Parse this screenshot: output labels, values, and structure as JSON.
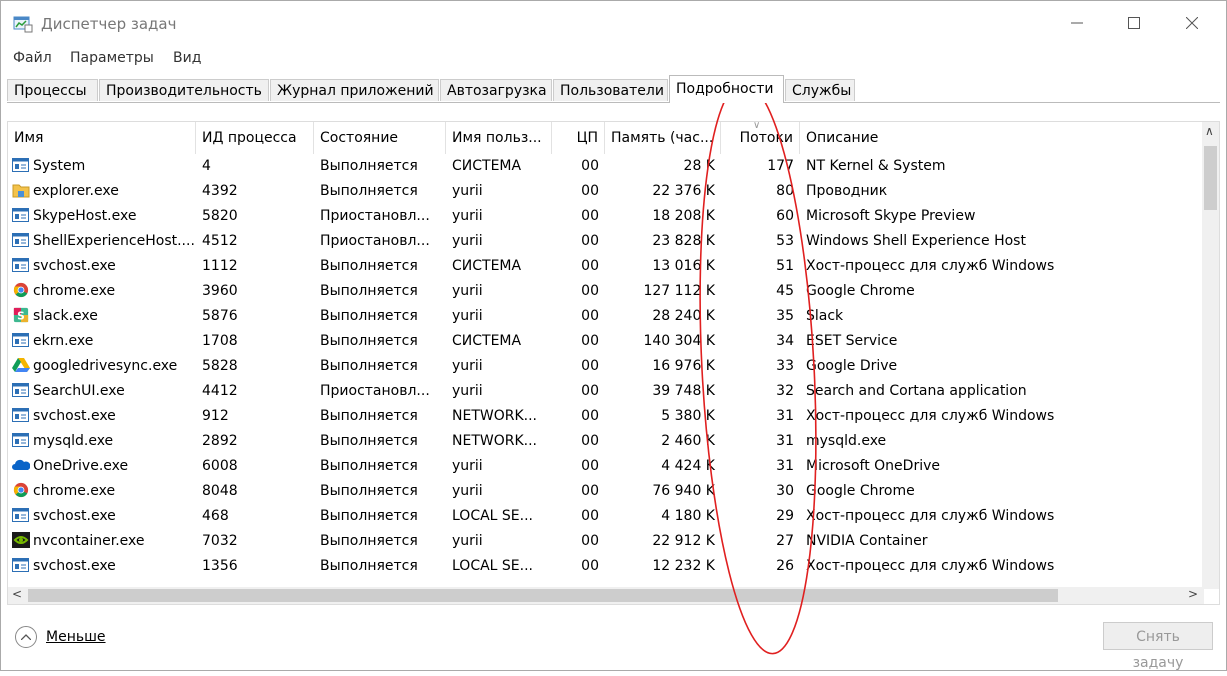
{
  "window": {
    "title": "Диспетчер задач"
  },
  "menu": [
    "Файл",
    "Параметры",
    "Вид"
  ],
  "tabs": [
    "Процессы",
    "Производительность",
    "Журнал приложений",
    "Автозагрузка",
    "Пользователи",
    "Подробности",
    "Службы"
  ],
  "active_tab": "Подробности",
  "columns": [
    "Имя",
    "ИД процесса",
    "Состояние",
    "Имя польз...",
    "ЦП",
    "Память (час...",
    "Потоки",
    "Описание"
  ],
  "sorted_column": "Потоки",
  "rows": [
    {
      "icon": "window-process-icon",
      "name": "System",
      "pid": "4",
      "status": "Выполняется",
      "user": "СИСТЕМА",
      "cpu": "00",
      "memory": "28 K",
      "threads": "177",
      "description": "NT Kernel & System"
    },
    {
      "icon": "folder-icon",
      "name": "explorer.exe",
      "pid": "4392",
      "status": "Выполняется",
      "user": "yurii",
      "cpu": "00",
      "memory": "22 376 K",
      "threads": "80",
      "description": "Проводник"
    },
    {
      "icon": "window-process-icon",
      "name": "SkypeHost.exe",
      "pid": "5820",
      "status": "Приостановл...",
      "user": "yurii",
      "cpu": "00",
      "memory": "18 208 K",
      "threads": "60",
      "description": "Microsoft Skype Preview"
    },
    {
      "icon": "window-process-icon",
      "name": "ShellExperienceHost....",
      "pid": "4512",
      "status": "Приостановл...",
      "user": "yurii",
      "cpu": "00",
      "memory": "23 828 K",
      "threads": "53",
      "description": "Windows Shell Experience Host"
    },
    {
      "icon": "window-process-icon",
      "name": "svchost.exe",
      "pid": "1112",
      "status": "Выполняется",
      "user": "СИСТЕМА",
      "cpu": "00",
      "memory": "13 016 K",
      "threads": "51",
      "description": "Хост-процесс для служб Windows"
    },
    {
      "icon": "chrome-icon",
      "name": "chrome.exe",
      "pid": "3960",
      "status": "Выполняется",
      "user": "yurii",
      "cpu": "00",
      "memory": "127 112 K",
      "threads": "45",
      "description": "Google Chrome"
    },
    {
      "icon": "slack-icon",
      "name": "slack.exe",
      "pid": "5876",
      "status": "Выполняется",
      "user": "yurii",
      "cpu": "00",
      "memory": "28 240 K",
      "threads": "35",
      "description": "Slack"
    },
    {
      "icon": "window-process-icon",
      "name": "ekrn.exe",
      "pid": "1708",
      "status": "Выполняется",
      "user": "СИСТЕМА",
      "cpu": "00",
      "memory": "140 304 K",
      "threads": "34",
      "description": "ESET Service"
    },
    {
      "icon": "google-drive-icon",
      "name": "googledrivesync.exe",
      "pid": "5828",
      "status": "Выполняется",
      "user": "yurii",
      "cpu": "00",
      "memory": "16 976 K",
      "threads": "33",
      "description": "Google Drive"
    },
    {
      "icon": "window-process-icon",
      "name": "SearchUI.exe",
      "pid": "4412",
      "status": "Приостановл...",
      "user": "yurii",
      "cpu": "00",
      "memory": "39 748 K",
      "threads": "32",
      "description": "Search and Cortana application"
    },
    {
      "icon": "window-process-icon",
      "name": "svchost.exe",
      "pid": "912",
      "status": "Выполняется",
      "user": "NETWORK...",
      "cpu": "00",
      "memory": "5 380 K",
      "threads": "31",
      "description": "Хост-процесс для служб Windows"
    },
    {
      "icon": "window-process-icon",
      "name": "mysqld.exe",
      "pid": "2892",
      "status": "Выполняется",
      "user": "NETWORK...",
      "cpu": "00",
      "memory": "2 460 K",
      "threads": "31",
      "description": "mysqld.exe"
    },
    {
      "icon": "onedrive-icon",
      "name": "OneDrive.exe",
      "pid": "6008",
      "status": "Выполняется",
      "user": "yurii",
      "cpu": "00",
      "memory": "4 424 K",
      "threads": "31",
      "description": "Microsoft OneDrive"
    },
    {
      "icon": "chrome-icon",
      "name": "chrome.exe",
      "pid": "8048",
      "status": "Выполняется",
      "user": "yurii",
      "cpu": "00",
      "memory": "76 940 K",
      "threads": "30",
      "description": "Google Chrome"
    },
    {
      "icon": "window-process-icon",
      "name": "svchost.exe",
      "pid": "468",
      "status": "Выполняется",
      "user": "LOCAL SE...",
      "cpu": "00",
      "memory": "4 180 K",
      "threads": "29",
      "description": "Хост-процесс для служб Windows"
    },
    {
      "icon": "nvidia-icon",
      "name": "nvcontainer.exe",
      "pid": "7032",
      "status": "Выполняется",
      "user": "yurii",
      "cpu": "00",
      "memory": "22 912 K",
      "threads": "27",
      "description": "NVIDIA Container"
    },
    {
      "icon": "window-process-icon",
      "name": "svchost.exe",
      "pid": "1356",
      "status": "Выполняется",
      "user": "LOCAL SE...",
      "cpu": "00",
      "memory": "12 232 K",
      "threads": "26",
      "description": "Хост-процесс для служб Windows"
    }
  ],
  "footer": {
    "less_label": "Меньше",
    "end_task_label": "Снять задачу"
  },
  "colors": {
    "annotation": "#e02020",
    "active_tab_bg": "#ffffff",
    "tab_bg": "#f0f0f0"
  }
}
